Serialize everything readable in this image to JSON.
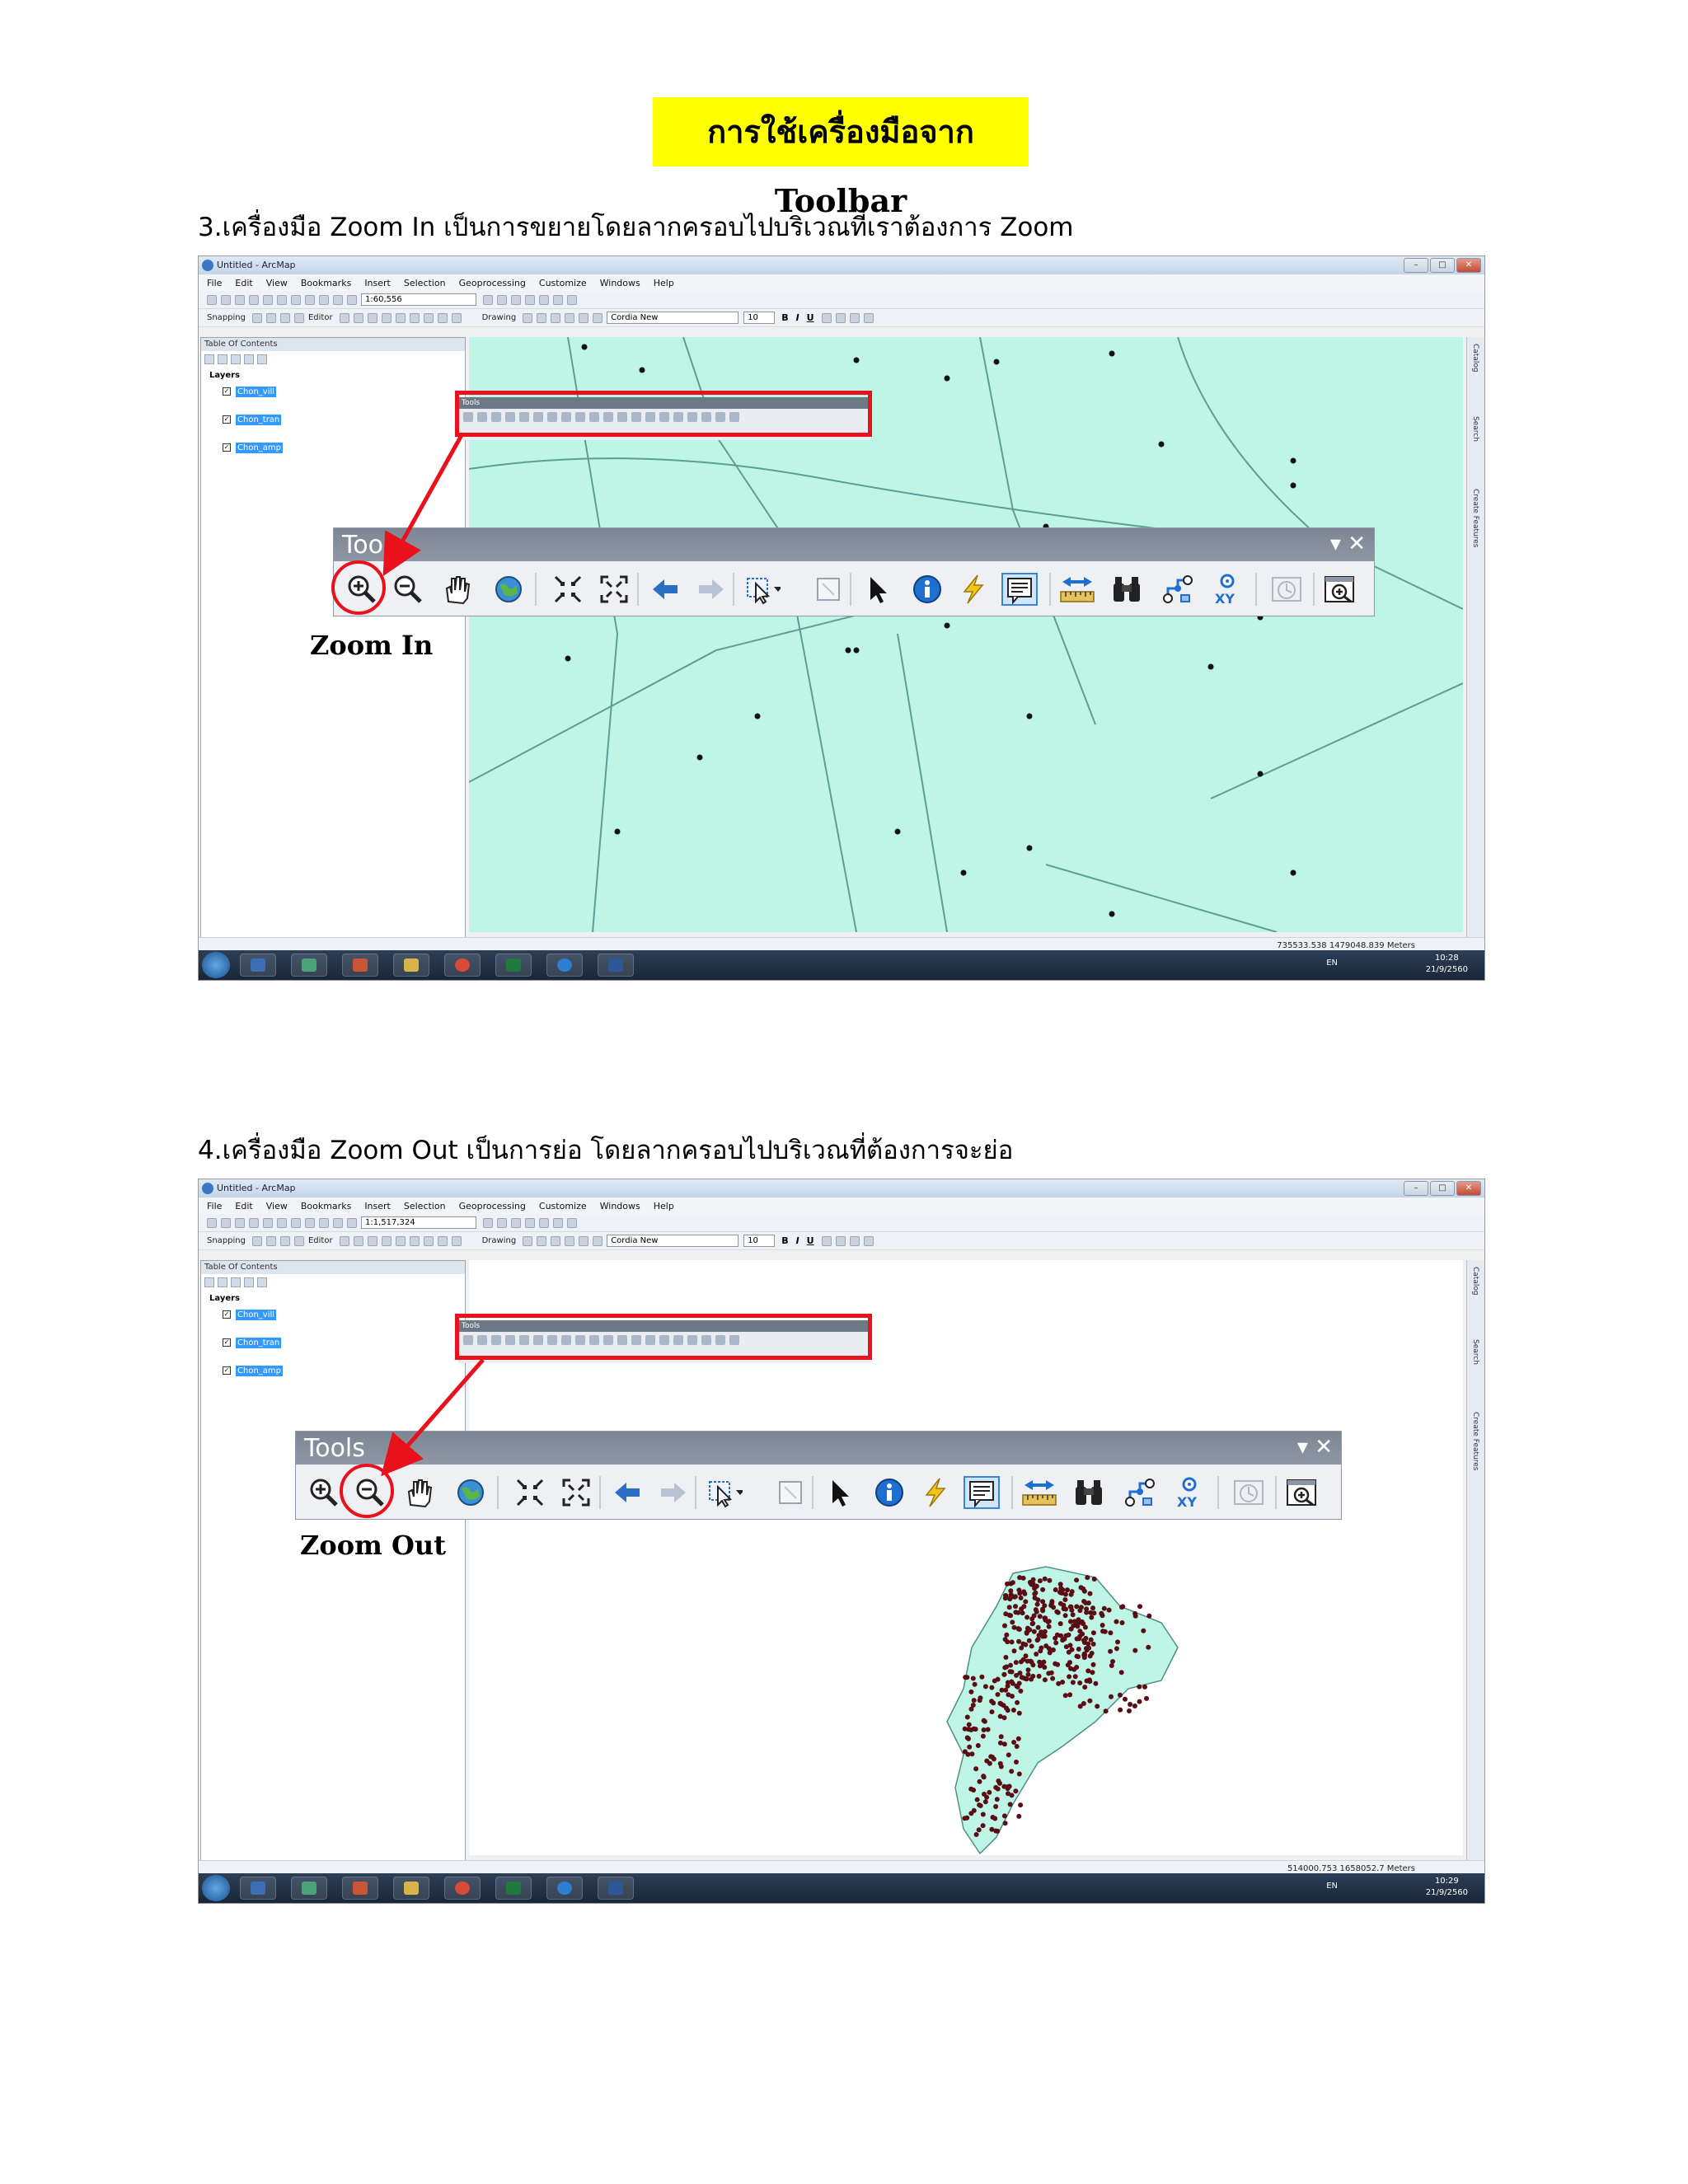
{
  "document": {
    "title": "การใช้เครื่องมือจาก Toolbar",
    "sections": [
      {
        "text": "3.เครื่องมือ Zoom In เป็นการขยายโดยลากครอบไปบริเวณที่เราต้องการ Zoom",
        "callout_label": "Zoom In",
        "scale_value": "1:60,556",
        "status_coords": "735533.538  1479048.839 Meters",
        "clock_time": "10:28",
        "clock_date": "21/9/2560"
      },
      {
        "text": "4.เครื่องมือ Zoom Out เป็นการย่อ โดยลากครอบไปบริเวณที่ต้องการจะย่อ",
        "callout_label": "Zoom Out",
        "scale_value": "1:1,517,324",
        "status_coords": "514000.753  1658052.7 Meters",
        "clock_time": "10:29",
        "clock_date": "21/9/2560"
      }
    ]
  },
  "arcmap": {
    "window_title": "Untitled - ArcMap",
    "menu": [
      "File",
      "Edit",
      "View",
      "Bookmarks",
      "Insert",
      "Selection",
      "Geoprocessing",
      "Customize",
      "Windows",
      "Help"
    ],
    "snapping_label": "Snapping",
    "editor_label": "Editor",
    "drawing_label": "Drawing",
    "font_name": "Cordia New",
    "font_size": "10",
    "format_buttons": [
      "B",
      "I",
      "U"
    ],
    "toc_title": "Table Of Contents",
    "layers_label": "Layers",
    "layers": [
      "Chon_vill",
      "Chon_tran",
      "Chon_amp"
    ],
    "side_tabs": [
      "Catalog",
      "Search",
      "Create Features"
    ],
    "tools_window_title": "Tools",
    "tools_small_title": "Tools",
    "tools_window_controls": "▾ ✕",
    "taskbar_lang": "EN",
    "tool_icons": [
      "zoom-in-icon",
      "zoom-out-icon",
      "pan-icon",
      "full-extent-icon",
      "fixed-zoom-in-icon",
      "fixed-zoom-out-icon",
      "back-icon",
      "forward-icon",
      "select-features-icon",
      "clear-selection-icon",
      "select-elements-icon",
      "identify-icon",
      "hyperlink-icon",
      "html-popup-icon",
      "measure-icon",
      "find-icon",
      "find-route-icon",
      "go-to-xy-icon",
      "time-slider-icon",
      "create-viewer-icon"
    ]
  },
  "colors": {
    "title_highlight": "#ffff00",
    "map_fill": "#bff5e4",
    "callout_red": "#e8111c",
    "village_dot": "#5a0d14"
  }
}
